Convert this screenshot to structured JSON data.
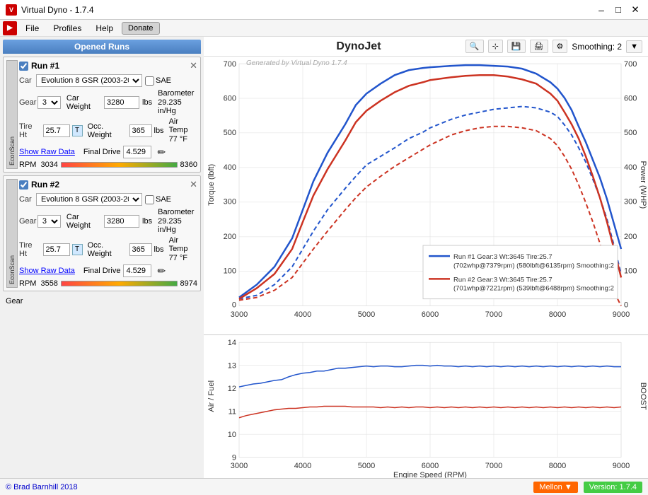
{
  "titlebar": {
    "title": "Virtual Dyno - 1.7.4",
    "icon": "VD",
    "controls": {
      "minimize": "–",
      "maximize": "□",
      "close": "✕"
    }
  },
  "menubar": {
    "file": "File",
    "profiles": "Profiles",
    "help": "Help",
    "donate": "Donate"
  },
  "left_panel": {
    "title": "Opened Runs",
    "run1": {
      "label": "Run #1",
      "car": "Evolution 8 GSR (2003-2005)",
      "sae": "SAE",
      "gear": "3",
      "car_weight": "3280",
      "car_weight_unit": "lbs",
      "barometer": "29.235 in/Hg",
      "tire_ht": "25.7",
      "occ_weight": "365",
      "occ_weight_unit": "lbs",
      "air_temp": "77",
      "air_temp_unit": "°F",
      "final_drive": "4.529",
      "show_raw": "Show Raw Data",
      "rpm": "3034",
      "rpm_max": "8360"
    },
    "run2": {
      "label": "Run #2",
      "car": "Evolution 8 GSR (2003-2005)",
      "sae": "SAE",
      "gear": "3",
      "car_weight": "3280",
      "car_weight_unit": "lbs",
      "barometer": "29.235 in/Hg",
      "tire_ht": "25.7",
      "occ_weight": "365",
      "occ_weight_unit": "lbs",
      "air_temp": "77",
      "air_temp_unit": "°F",
      "final_drive": "4.529",
      "show_raw": "Show Raw Data",
      "rpm": "3558",
      "rpm_max": "8974"
    }
  },
  "chart_header": {
    "title": "DynoJet",
    "smoothing_label": "Smoothing: 2"
  },
  "chart": {
    "watermark": "Generated by Virtual Dyno 1.7.4",
    "y_left_label": "Torque (lbft)",
    "y_right_label": "Power (WHP)",
    "x_label": "Engine Speed (RPM)",
    "y_left_min": 0,
    "y_left_max": 700,
    "y_right_min": 0,
    "y_right_max": 700,
    "x_min": 3000,
    "x_max": 9000,
    "legend": [
      {
        "color": "#2255cc",
        "label": "Run #1 Gear:3 Wt:3645 Tire:25.7",
        "sublabel": "(702whp@7379rpm) (580lbft@6135rpm) Smoothing:2"
      },
      {
        "color": "#cc3322",
        "label": "Run #2 Gear:3 Wt:3645 Tire:25.7",
        "sublabel": "(701whp@7221rpm) (539lbft@6488rpm) Smoothing:2"
      }
    ]
  },
  "sub_chart": {
    "y_left_label": "Air / Fuel",
    "y_right_label": "BOOST",
    "y_left_min": 9,
    "y_left_max": 14,
    "y_right_min": 0,
    "y_right_max": 0
  },
  "footer": {
    "credit": "© Brad Barnhill 2018",
    "mellon": "Mellon",
    "version": "Version: 1.7.4"
  }
}
